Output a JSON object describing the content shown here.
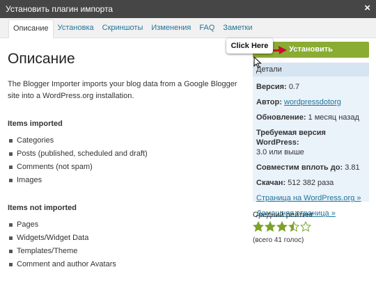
{
  "window": {
    "title": "Установить плагин импорта",
    "close_label": "×"
  },
  "tabs": [
    {
      "label": "Описание",
      "active": true
    },
    {
      "label": "Установка"
    },
    {
      "label": "Скриншоты"
    },
    {
      "label": "Изменения"
    },
    {
      "label": "FAQ"
    },
    {
      "label": "Заметки"
    }
  ],
  "main": {
    "title": "Описание",
    "description": "The Blogger Importer imports your blog data from a Google Blogger site into a WordPress.org installation.",
    "imported_heading": "Items imported",
    "imported_items": [
      "Categories",
      "Posts (published, scheduled and draft)",
      "Comments (not spam)",
      "Images"
    ],
    "not_imported_heading": "Items not imported",
    "not_imported_items": [
      "Pages",
      "Widgets/Widget Data",
      "Templates/Theme",
      "Comment and author Avatars"
    ]
  },
  "callout": {
    "label": "Click Here"
  },
  "install_button": {
    "label": "Установить",
    "color": "#8aac33"
  },
  "details": {
    "heading": "Детали",
    "version_label": "Версия:",
    "version_value": "0.7",
    "author_label": "Автор:",
    "author_value": "wordpressdotorg",
    "updated_label": "Обновление:",
    "updated_value": "1 месяц назад",
    "requires_label": "Требуемая версия WordPress:",
    "requires_value": "3.0 или выше",
    "compatible_label": "Совместим вплоть до:",
    "compatible_value": "3.81",
    "downloads_label": "Скачан:",
    "downloads_value": "512 382 раза",
    "plugin_page_link": "Страница на WordPress.org »",
    "home_page_link": "Домашняя страница »"
  },
  "rating": {
    "label": "Средний рейтинг",
    "stars": 3.5,
    "max_stars": 5,
    "count_text": "(всего 41 голос)",
    "star_color": "#7ca22a"
  }
}
